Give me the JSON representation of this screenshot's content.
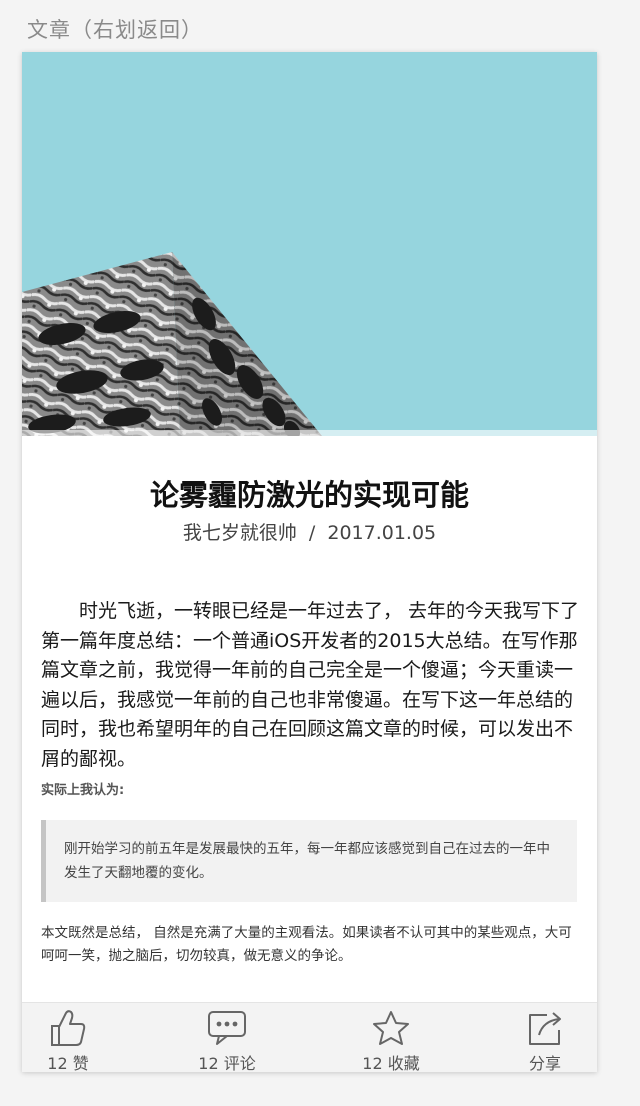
{
  "header": {
    "title": "文章（右划返回）"
  },
  "article": {
    "hero_image": "building-photo",
    "title": "论雾霾防激光的实现可能",
    "author": "我七岁就很帅",
    "separator": "/",
    "date": "2017.01.05",
    "paragraph": "时光飞逝，一转眼已经是一年过去了， 去年的今天我写下了第一篇年度总结：一个普通iOS开发者的2015大总结。在写作那篇文章之前，我觉得一年前的自己完全是一个傻逼；今天重读一遍以后，我感觉一年前的自己也非常傻逼。在写下这一年总结的同时，我也希望明年的自己在回顾这篇文章的时候，可以发出不屑的鄙视。",
    "subheading": "实际上我认为:",
    "quote": "刚开始学习的前五年是发展最快的五年，每一年都应该感觉到自己在过去的一年中发生了天翻地覆的变化。",
    "summary": "本文既然是总结， 自然是充满了大量的主观看法。如果读者不认可其中的某些观点，大可呵呵一笑，抛之脑后，切勿较真，做无意义的争论。"
  },
  "toolbar": {
    "like": {
      "icon": "thumbs-up-icon",
      "label": "12 赞"
    },
    "comment": {
      "icon": "comment-icon",
      "label": "12 评论"
    },
    "favorite": {
      "icon": "star-icon",
      "label": "12 收藏"
    },
    "share": {
      "icon": "share-icon",
      "label": "分享"
    }
  },
  "colors": {
    "hero_sky": "#96d5de",
    "page_background": "#f4f4f4",
    "toolbar_background": "#f3f3f3",
    "icon_stroke": "#666666"
  }
}
